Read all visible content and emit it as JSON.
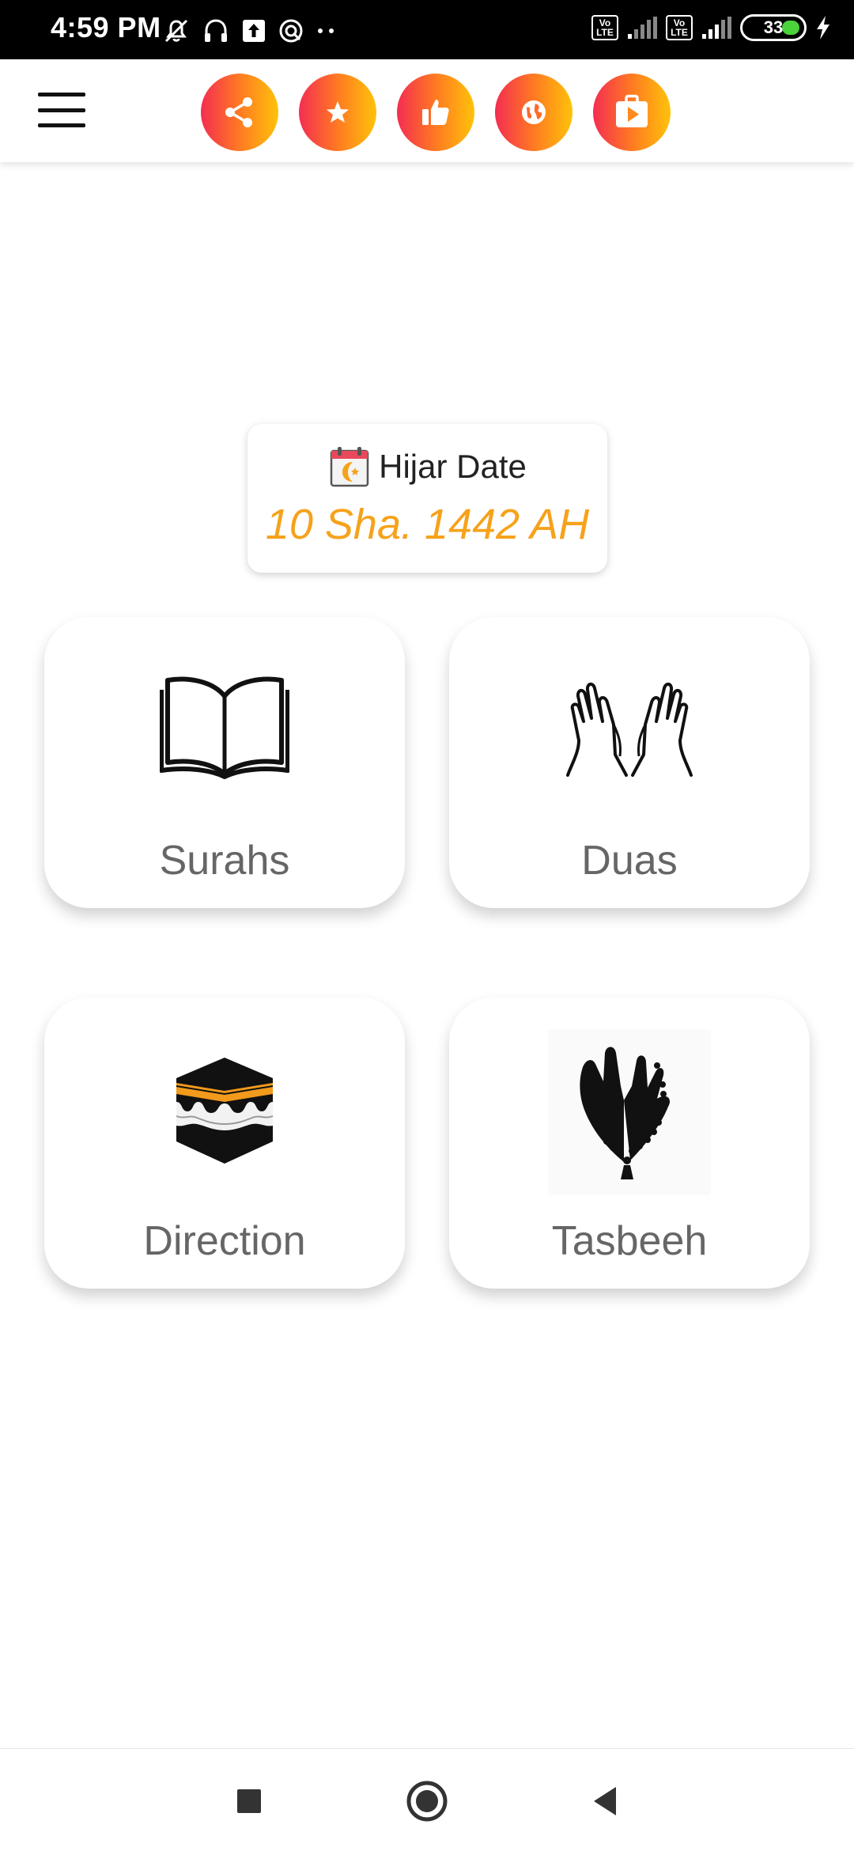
{
  "status_bar": {
    "time": "4:59 PM",
    "battery_level": "33",
    "lte_label_top": "Vo",
    "lte_label_bottom": "LTE",
    "icons": [
      "mute-icon",
      "headphones-icon",
      "upload-icon",
      "data-saver-icon",
      "more-dots-icon",
      "volte-icon",
      "signal-icon",
      "battery-icon",
      "charging-icon"
    ]
  },
  "app_bar": {
    "menu_icon": "hamburger-menu-icon",
    "actions": [
      {
        "name": "share",
        "icon": "share-icon"
      },
      {
        "name": "rate",
        "icon": "star-icon"
      },
      {
        "name": "like",
        "icon": "thumbs-up-icon"
      },
      {
        "name": "website",
        "icon": "globe-icon"
      },
      {
        "name": "more-apps",
        "icon": "play-store-icon"
      }
    ],
    "accent_gradient": [
      "#f42d52",
      "#ff7a22",
      "#ffc20a"
    ]
  },
  "hijri_card": {
    "label": "Hijar Date",
    "value": "10 Sha. 1442 AH",
    "value_color": "#f6a21b",
    "icon": "calendar-moon-icon"
  },
  "tiles": [
    {
      "label": "Surahs",
      "icon": "open-book-icon"
    },
    {
      "label": "Duas",
      "icon": "praying-hands-icon"
    },
    {
      "label": "Direction",
      "icon": "kaaba-icon"
    },
    {
      "label": "Tasbeeh",
      "icon": "prayer-beads-icon"
    }
  ],
  "nav_bar": {
    "buttons": [
      "recents-icon",
      "home-icon",
      "back-icon"
    ]
  }
}
